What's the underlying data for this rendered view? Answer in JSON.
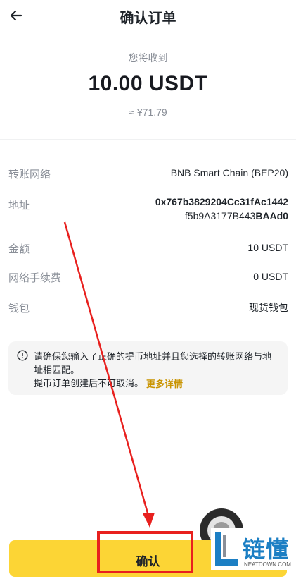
{
  "header": {
    "title": "确认订单"
  },
  "summary": {
    "receive_label": "您将收到",
    "amount": "10.00 USDT",
    "fiat": "≈ ¥71.79"
  },
  "details": {
    "network_label": "转账网络",
    "network_value": "BNB Smart Chain (BEP20)",
    "address_label": "地址",
    "address_line1": "0x767b3829204Cc31fAc1442",
    "address_line2_regular": "f5b9A3177B443",
    "address_line2_bold": "BAAd0",
    "amount_label": "金额",
    "amount_value": "10 USDT",
    "fee_label": "网络手续费",
    "fee_value": "0 USDT",
    "wallet_label": "钱包",
    "wallet_value": "现货钱包"
  },
  "notice": {
    "text1": "请确保您输入了正确的提币地址并且您选择的转账网络与地址相匹配。",
    "text2": "提币订单创建后不可取消。",
    "more": "更多详情"
  },
  "footer": {
    "confirm_label": "确认"
  },
  "watermark": {
    "brand": "链懂",
    "site": "NEATDOWN.COM"
  },
  "colors": {
    "accent": "#fcd535",
    "link": "#c99400",
    "annotation": "#e8201e"
  }
}
